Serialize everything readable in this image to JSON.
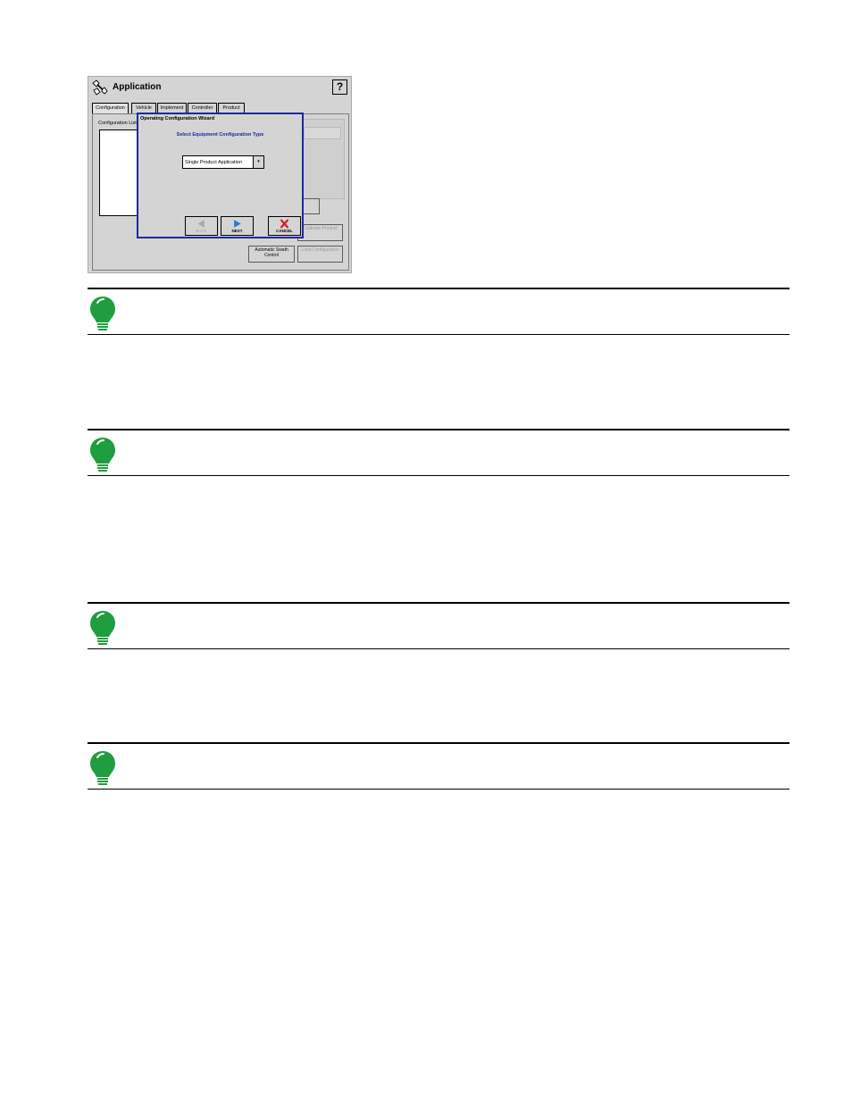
{
  "window": {
    "title": "Application",
    "help_label": "?"
  },
  "tabs": [
    {
      "label": "Configuration",
      "active": true
    },
    {
      "label": "Vehicle",
      "active": false
    },
    {
      "label": "Implement",
      "active": false
    },
    {
      "label": "Controller",
      "active": false
    },
    {
      "label": "Product",
      "active": false
    }
  ],
  "config_panel": {
    "list_label": "Configuration List"
  },
  "background_buttons": {
    "automatic_swath_control": "Automatic Swath Control",
    "calibrate_product": "Calibrate Product",
    "load_configuration": "Load Configuration"
  },
  "wizard": {
    "title": "Operating Configuration Wizard",
    "heading": "Select Equipment Configuration Type",
    "dropdown_value": "Single Product Application",
    "buttons": {
      "back": "BACK",
      "next": "NEXT",
      "cancel": "CANCEL"
    }
  },
  "notes": [
    {
      "text": ""
    },
    {
      "text": ""
    },
    {
      "text": ""
    },
    {
      "text": ""
    }
  ],
  "colors": {
    "wizard_border": "#1a2aa0",
    "bulb_green": "#1e9e3e",
    "next_arrow": "#1f7ad8",
    "cancel_x": "#d42020"
  }
}
